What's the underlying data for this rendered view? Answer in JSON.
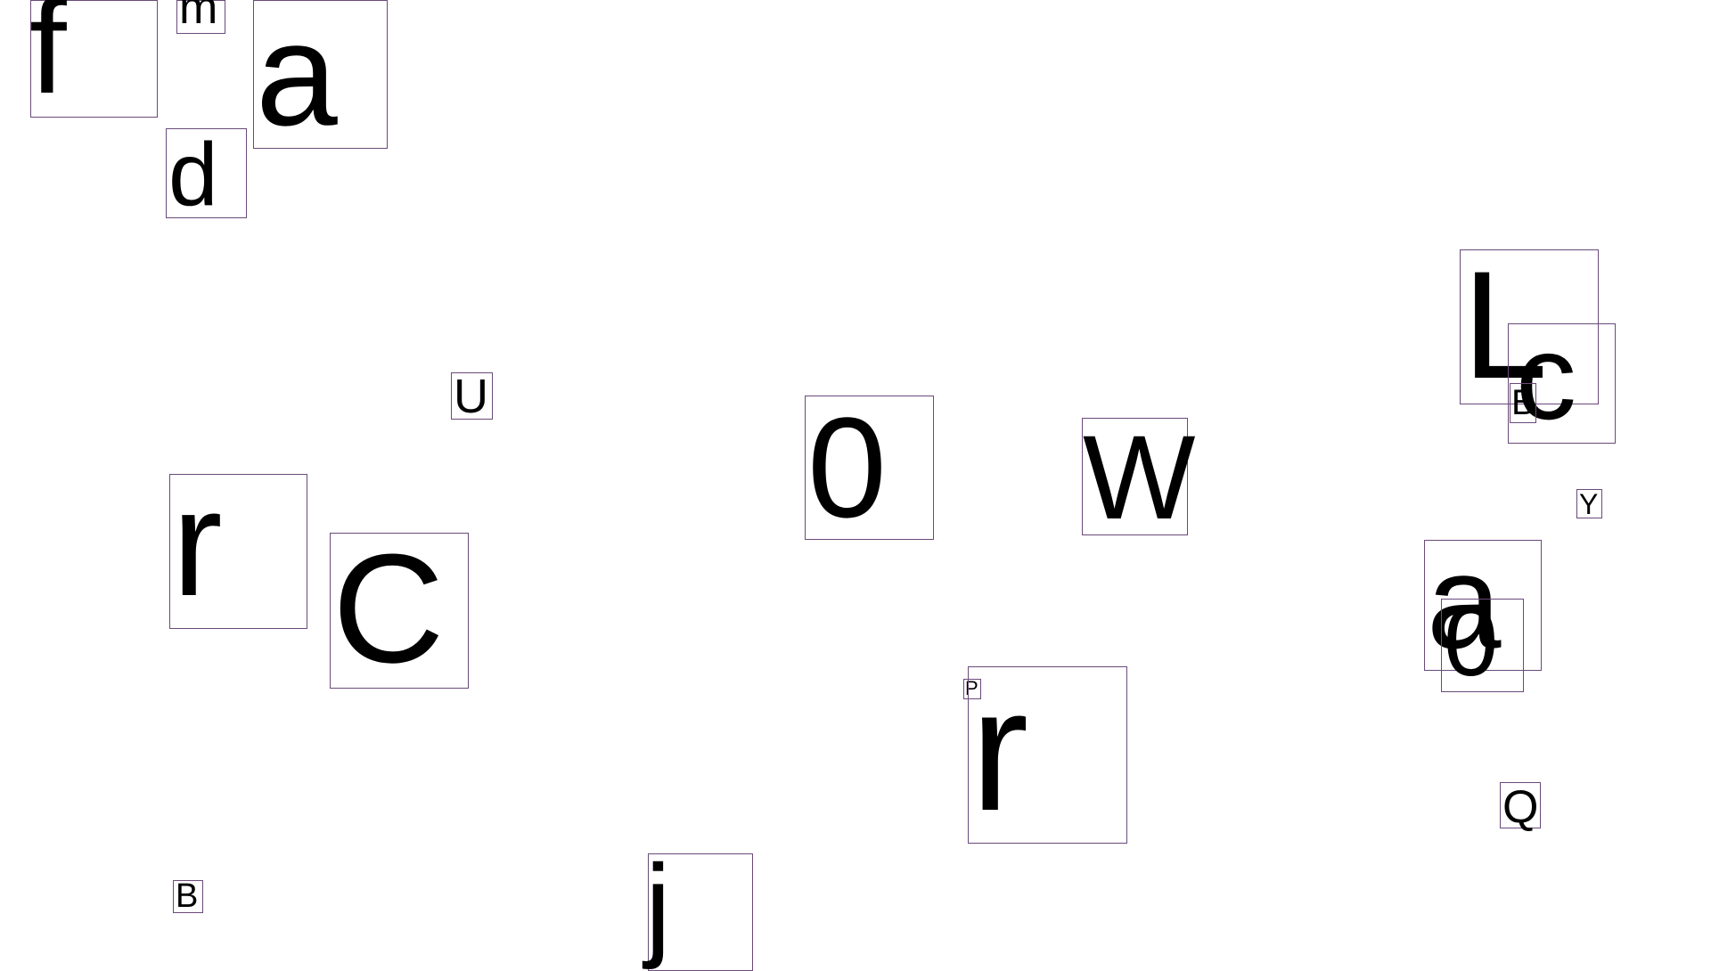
{
  "canvas": {
    "background": "#ffffff",
    "box_border_color": "#6a4a7a",
    "glyph_color": "#000000"
  },
  "glyphs": [
    {
      "char": "f"
    },
    {
      "char": "m"
    },
    {
      "char": "a"
    },
    {
      "char": "d"
    },
    {
      "char": "U"
    },
    {
      "char": "0"
    },
    {
      "char": "W"
    },
    {
      "char": "L"
    },
    {
      "char": "c"
    },
    {
      "char": "B"
    },
    {
      "char": "Y"
    },
    {
      "char": "r"
    },
    {
      "char": "C"
    },
    {
      "char": "a"
    },
    {
      "char": "0"
    },
    {
      "char": "P"
    },
    {
      "char": "r"
    },
    {
      "char": "Q"
    },
    {
      "char": "B"
    },
    {
      "char": "j"
    }
  ]
}
